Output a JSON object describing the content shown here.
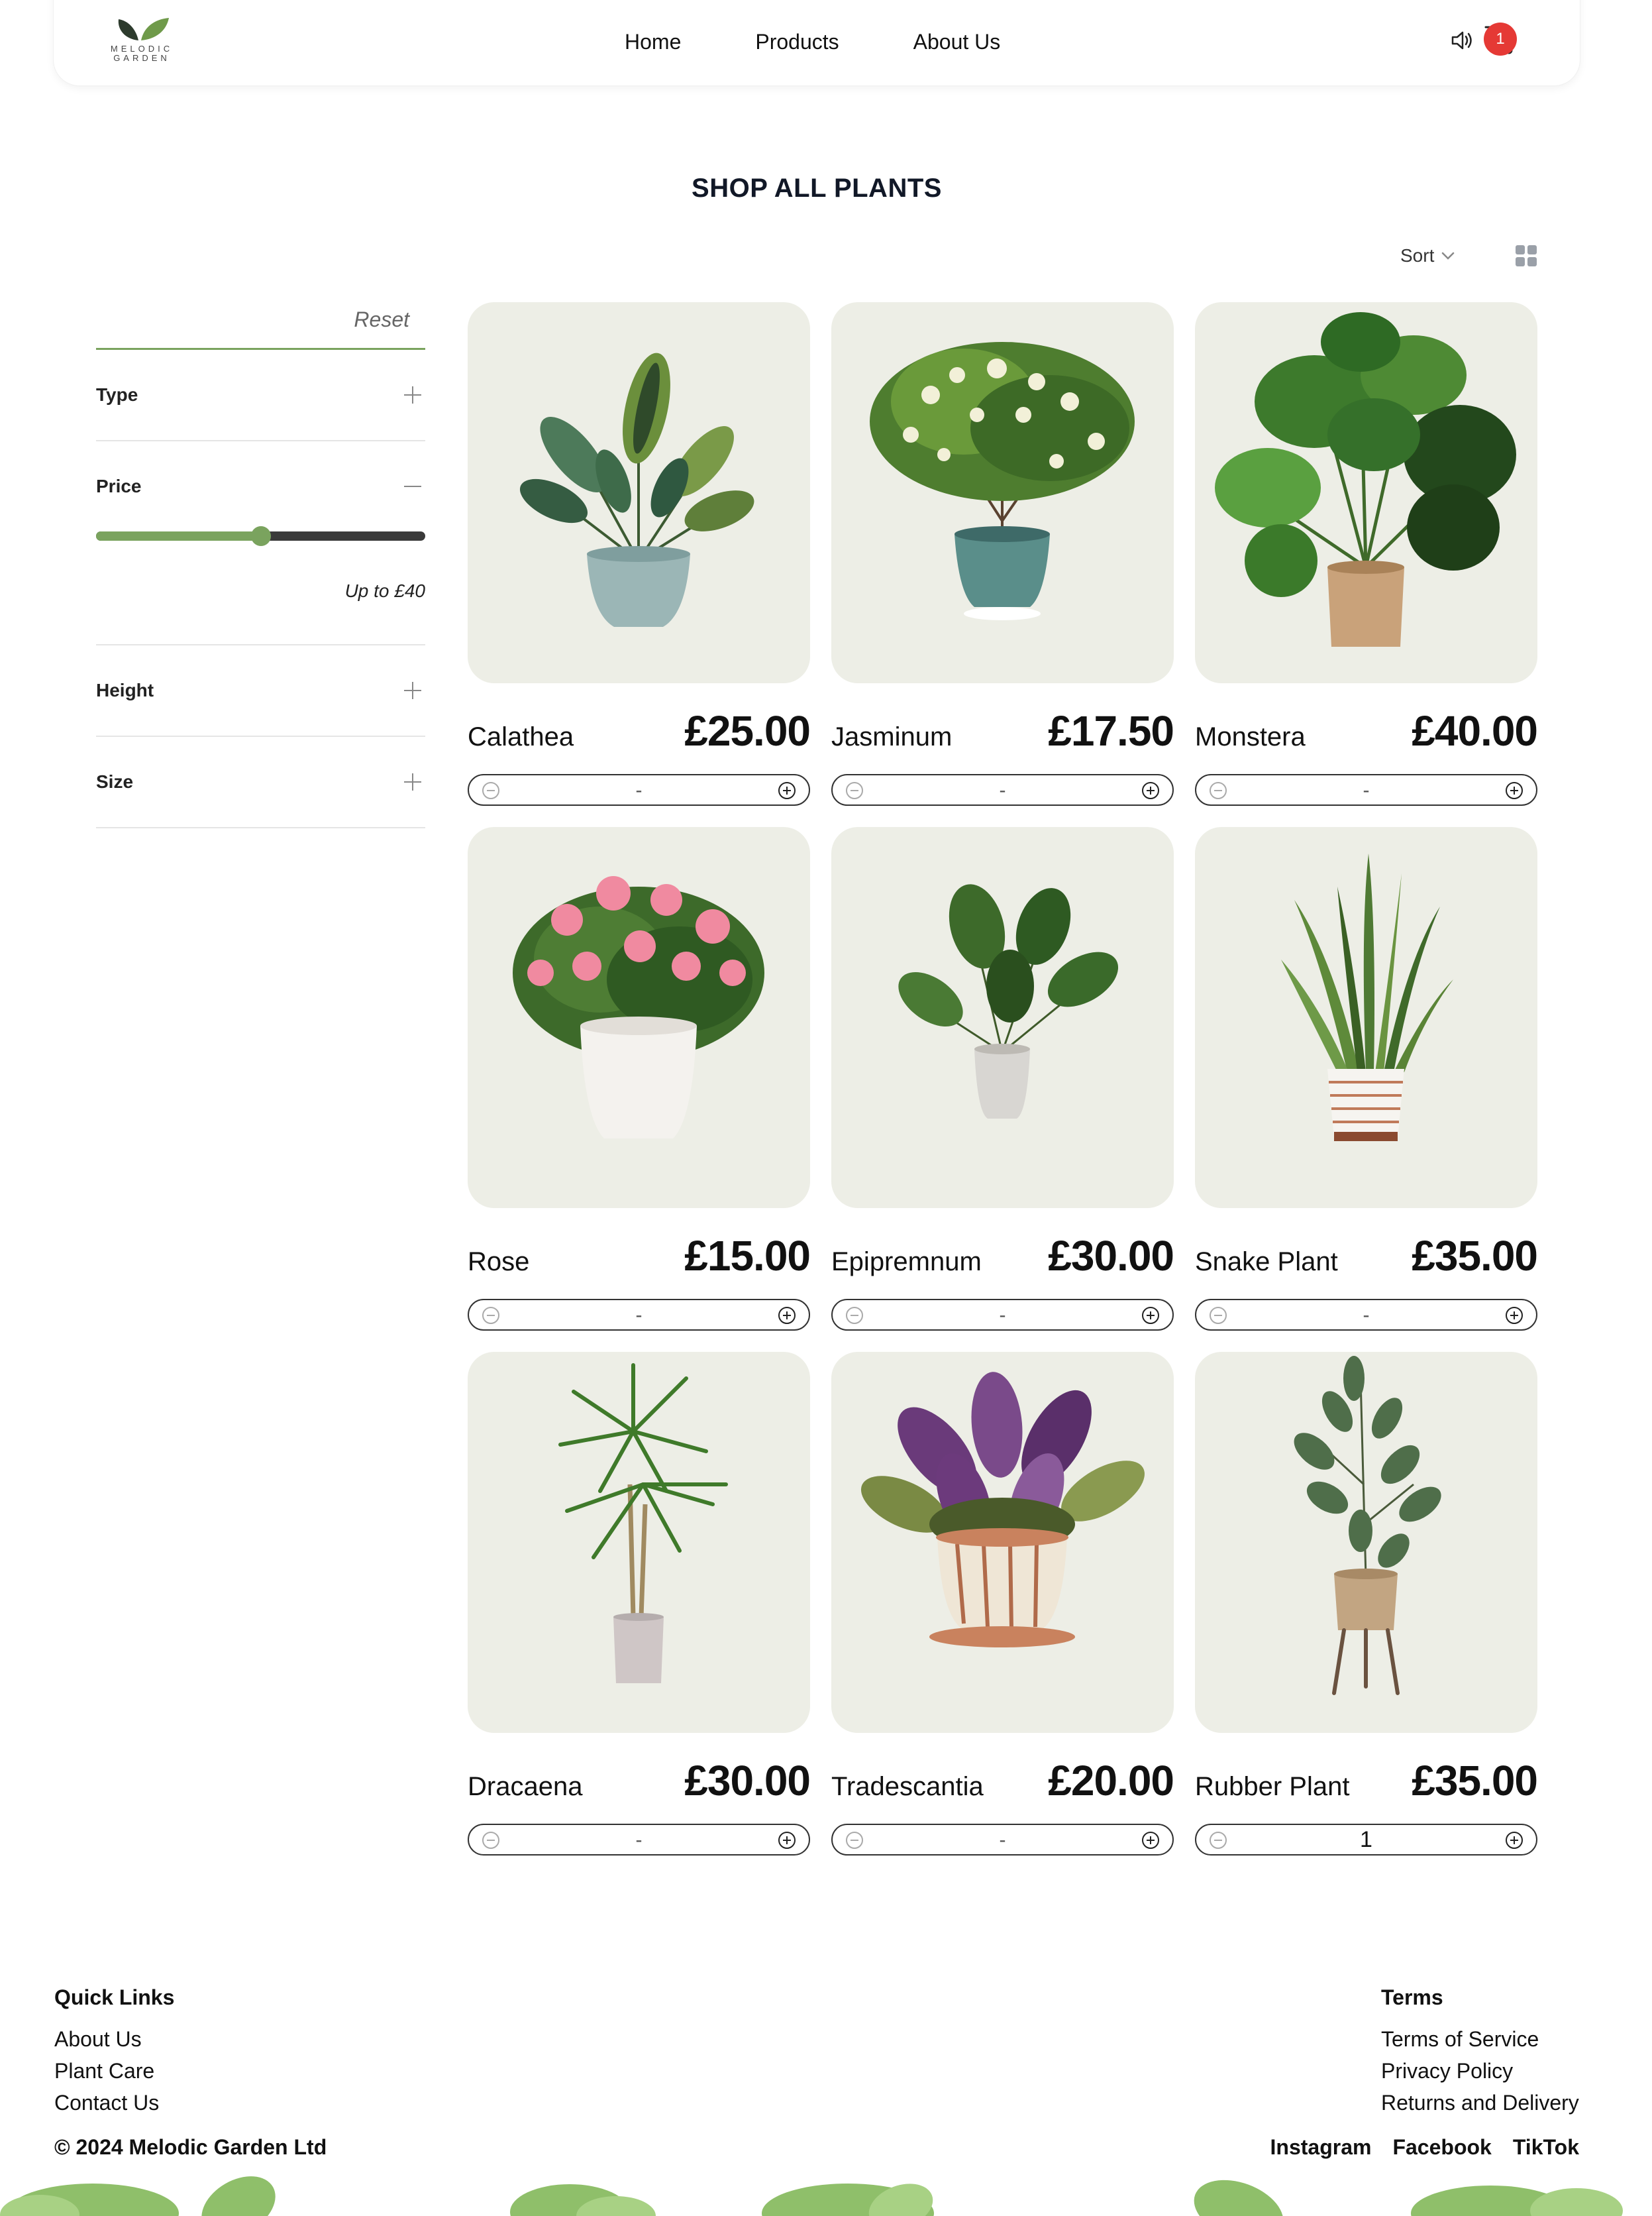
{
  "brand": {
    "logo_text": "MELODIC GARDEN"
  },
  "nav": {
    "items": [
      "Home",
      "Products",
      "About Us"
    ]
  },
  "cart": {
    "badge_count": "1"
  },
  "page": {
    "title": "SHOP ALL PLANTS",
    "sort_label": "Sort"
  },
  "filters": {
    "reset_label": "Reset",
    "type_label": "Type",
    "price_label": "Price",
    "price_note": "Up to £40",
    "price_slider_fraction": 0.5,
    "height_label": "Height",
    "size_label": "Size"
  },
  "products": [
    {
      "name": "Calathea",
      "price": "£25.00",
      "qty": "-"
    },
    {
      "name": "Jasminum",
      "price": "£17.50",
      "qty": "-"
    },
    {
      "name": "Monstera",
      "price": "£40.00",
      "qty": "-"
    },
    {
      "name": "Rose",
      "price": "£15.00",
      "qty": "-"
    },
    {
      "name": "Epipremnum",
      "price": "£30.00",
      "qty": "-"
    },
    {
      "name": "Snake Plant",
      "price": "£35.00",
      "qty": "-"
    },
    {
      "name": "Dracaena",
      "price": "£30.00",
      "qty": "-"
    },
    {
      "name": "Tradescantia",
      "price": "£20.00",
      "qty": "-"
    },
    {
      "name": "Rubber Plant",
      "price": "£35.00",
      "qty": "1"
    }
  ],
  "footer": {
    "quick_links_heading": "Quick Links",
    "quick_links": [
      "About Us",
      "Plant Care",
      "Contact Us"
    ],
    "terms_heading": "Terms",
    "terms_links": [
      "Terms of Service",
      "Privacy Policy",
      "Returns and Delivery"
    ],
    "copyright": "© 2024 Melodic Garden Ltd",
    "socials": [
      "Instagram",
      "Facebook",
      "TikTok"
    ]
  },
  "colors": {
    "accent_green": "#7aa35e",
    "card_bg": "#edeee6",
    "badge_red": "#e53935"
  }
}
